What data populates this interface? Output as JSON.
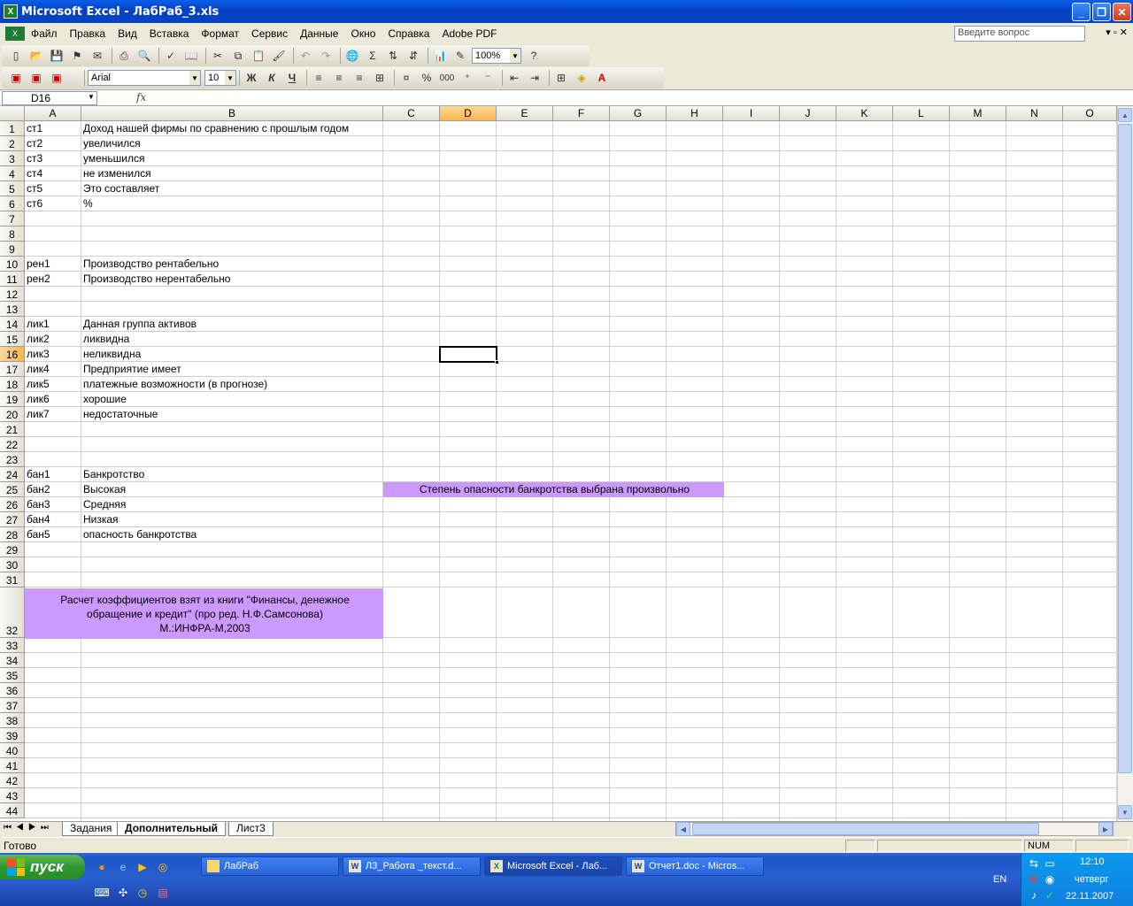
{
  "window": {
    "title": "Microsoft Excel - ЛабРаб_3.xls",
    "icon": "excel-icon"
  },
  "menu": {
    "items": [
      "Файл",
      "Правка",
      "Вид",
      "Вставка",
      "Формат",
      "Сервис",
      "Данные",
      "Окно",
      "Справка",
      "Adobe PDF"
    ],
    "help_placeholder": "Введите вопрос"
  },
  "toolbar": {
    "zoom": "100%",
    "font_name": "Arial",
    "font_size": "10",
    "bold": "Ж",
    "italic": "К",
    "underline": "Ч",
    "sum": "Σ",
    "percent": "%",
    "thousands": "000"
  },
  "formula_bar": {
    "name_box": "D16",
    "fx": "fx",
    "content": ""
  },
  "columns": [
    "A",
    "B",
    "C",
    "D",
    "E",
    "F",
    "G",
    "H",
    "I",
    "J",
    "K",
    "L",
    "M",
    "N",
    "O"
  ],
  "selected_column": "D",
  "selected_row": "16",
  "rows": [
    "1",
    "2",
    "3",
    "4",
    "5",
    "6",
    "7",
    "8",
    "9",
    "10",
    "11",
    "12",
    "13",
    "14",
    "15",
    "16",
    "17",
    "18",
    "19",
    "20",
    "21",
    "22",
    "23",
    "24",
    "25",
    "26",
    "27",
    "28",
    "29",
    "30",
    "31",
    "32",
    "33",
    "34",
    "35",
    "36",
    "37",
    "38",
    "39",
    "40",
    "41",
    "42",
    "43",
    "44"
  ],
  "cells": [
    {
      "row": 1,
      "a": "ст1",
      "b": "Доход нашей фирмы по сравнению с прошлым годом"
    },
    {
      "row": 2,
      "a": "ст2",
      "b": " увеличился"
    },
    {
      "row": 3,
      "a": "ст3",
      "b": " уменьшился"
    },
    {
      "row": 4,
      "a": "ст4",
      "b": " не изменился"
    },
    {
      "row": 5,
      "a": "ст5",
      "b": "Это составляет"
    },
    {
      "row": 6,
      "a": "ст6",
      "b": " %"
    },
    {
      "row": 10,
      "a": "рен1",
      "b": "Производство рентабельно"
    },
    {
      "row": 11,
      "a": "рен2",
      "b": "Производство нерентабельно"
    },
    {
      "row": 14,
      "a": "лик1",
      "b": "Данная группа активов"
    },
    {
      "row": 15,
      "a": "лик2",
      "b": "ликвидна"
    },
    {
      "row": 16,
      "a": "лик3",
      "b": "неликвидна"
    },
    {
      "row": 17,
      "a": "лик4",
      "b": "Предприятие имеет"
    },
    {
      "row": 18,
      "a": "лик5",
      "b": " платежные возможности (в прогнозе)"
    },
    {
      "row": 19,
      "a": "лик6",
      "b": "хорошие"
    },
    {
      "row": 20,
      "a": "лик7",
      "b": "недостаточные"
    },
    {
      "row": 24,
      "a": "бан1",
      "b": "Банкротство"
    },
    {
      "row": 25,
      "a": "бан2",
      "b": "Высокая"
    },
    {
      "row": 26,
      "a": "бан3",
      "b": "Средняя"
    },
    {
      "row": 27,
      "a": "бан4",
      "b": "Низкая"
    },
    {
      "row": 28,
      "a": "бан5",
      "b": " опасность банкротства"
    }
  ],
  "note_row25": "Степень опасности банкротства выбрана произвольно",
  "note_row32": [
    "Расчет коэффициентов взят из книги \"Финансы, денежное",
    "обращение и кредит\" (про ред. Н.Ф.Самсонова)",
    "М.:ИНФРА-М,2003"
  ],
  "highlight_color": "#CC99FF",
  "sheets": [
    {
      "label": "Задания",
      "active": false
    },
    {
      "label": "Дополнительный",
      "active": true
    },
    {
      "label": "Лист3",
      "active": false
    }
  ],
  "status": {
    "ready": "Готово",
    "num": "NUM"
  },
  "taskbar": {
    "start": "пуск",
    "tasks": [
      {
        "label": "ЛабРаб",
        "icon": "folder-icon",
        "active": false
      },
      {
        "label": "Л3_Работа _текст.d...",
        "icon": "word-icon",
        "active": false
      },
      {
        "label": "Microsoft Excel - Лаб...",
        "icon": "excel-icon",
        "active": true
      },
      {
        "label": "Отчет1.doc - Micros...",
        "icon": "word-icon",
        "active": false
      }
    ],
    "lang": "EN",
    "time": "12:10",
    "day": "четверг",
    "date": "22.11.2007"
  }
}
